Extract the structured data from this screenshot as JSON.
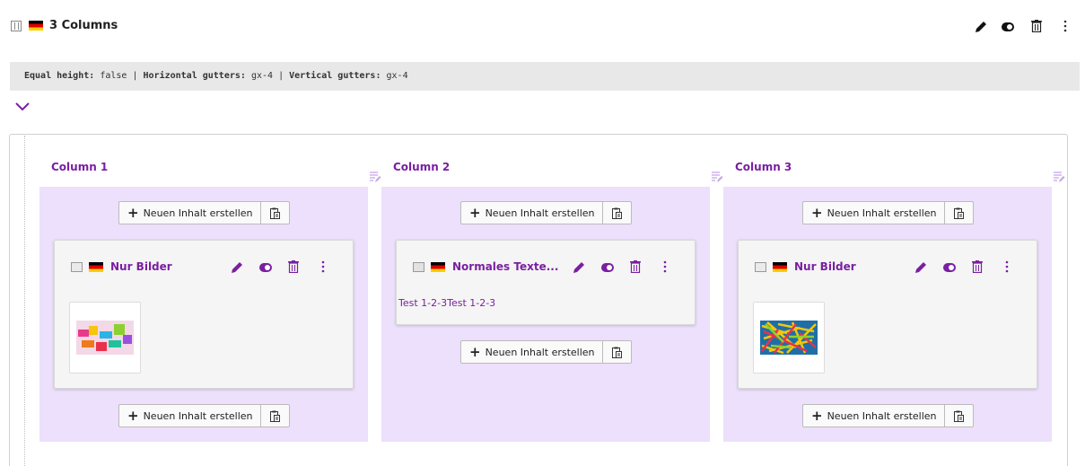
{
  "header": {
    "title": "3 Columns",
    "type_icon": "grid-columns-icon",
    "flag": "de-flag",
    "actions": [
      "pencil-icon",
      "toggle-icon",
      "trash-icon",
      "more-vertical-icon"
    ]
  },
  "settings": {
    "equal_height_label": "Equal height:",
    "equal_height_value": "false",
    "sep1": "|",
    "horizontal_label": "Horizontal gutters:",
    "horizontal_value": "gx-4",
    "sep2": "|",
    "vertical_label": "Vertical gutters:",
    "vertical_value": "gx-4"
  },
  "new_content_label": "Neuen Inhalt erstellen",
  "columns": [
    {
      "title": "Column 1",
      "cards": [
        {
          "title": "Nur Bilder",
          "type_icon": "image-content-icon",
          "kind": "image"
        }
      ]
    },
    {
      "title": "Column 2",
      "cards": [
        {
          "title": "Normales Texte...",
          "type_icon": "text-content-icon",
          "kind": "text",
          "body": "Test 1-2-3Test 1-2-3"
        }
      ]
    },
    {
      "title": "Column 3",
      "cards": [
        {
          "title": "Nur Bilder",
          "type_icon": "image-content-icon",
          "kind": "image"
        }
      ]
    }
  ],
  "colors": {
    "accent": "#7a1fa2",
    "column_bg": "#ece0fc",
    "infobar_bg": "#e8e8e8"
  }
}
